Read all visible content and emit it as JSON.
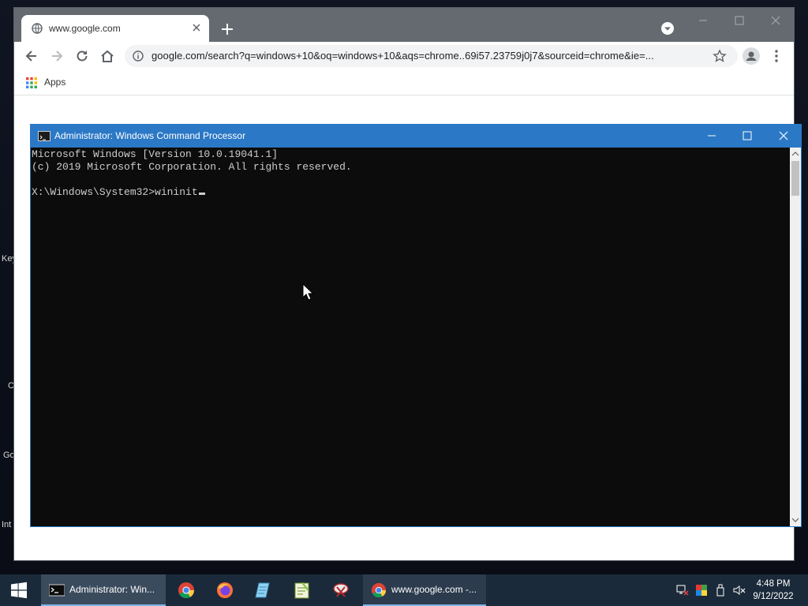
{
  "desktop": {
    "labels": [
      "Key",
      "C",
      "Go",
      "Int"
    ]
  },
  "chrome": {
    "tab_title": "www.google.com",
    "url": "google.com/search?q=windows+10&oq=windows+10&aqs=chrome..69i57.23759j0j7&sourceid=chrome&ie=...",
    "bookmarks_apps_label": "Apps",
    "colors": {
      "titlebar": "#646a70",
      "omnibox": "#f1f3f4"
    }
  },
  "cmd": {
    "title": "Administrator: Windows Command Processor",
    "lines": [
      "Microsoft Windows [Version 10.0.19041.1]",
      "(c) 2019 Microsoft Corporation. All rights reserved.",
      "",
      "X:\\Windows\\System32>wininit"
    ],
    "colors": {
      "titlebar": "#2b78c6",
      "background": "#0c0c0c",
      "text": "#cccccc"
    }
  },
  "taskbar": {
    "cmd_task_label": "Administrator: Win...",
    "chrome_task_label": "www.google.com -...",
    "pinned": [
      "chrome-icon",
      "firefox-icon",
      "notepad-icon",
      "notepad-plus-icon",
      "snipping-icon"
    ],
    "time": "4:48 PM",
    "date": "9/12/2022"
  }
}
